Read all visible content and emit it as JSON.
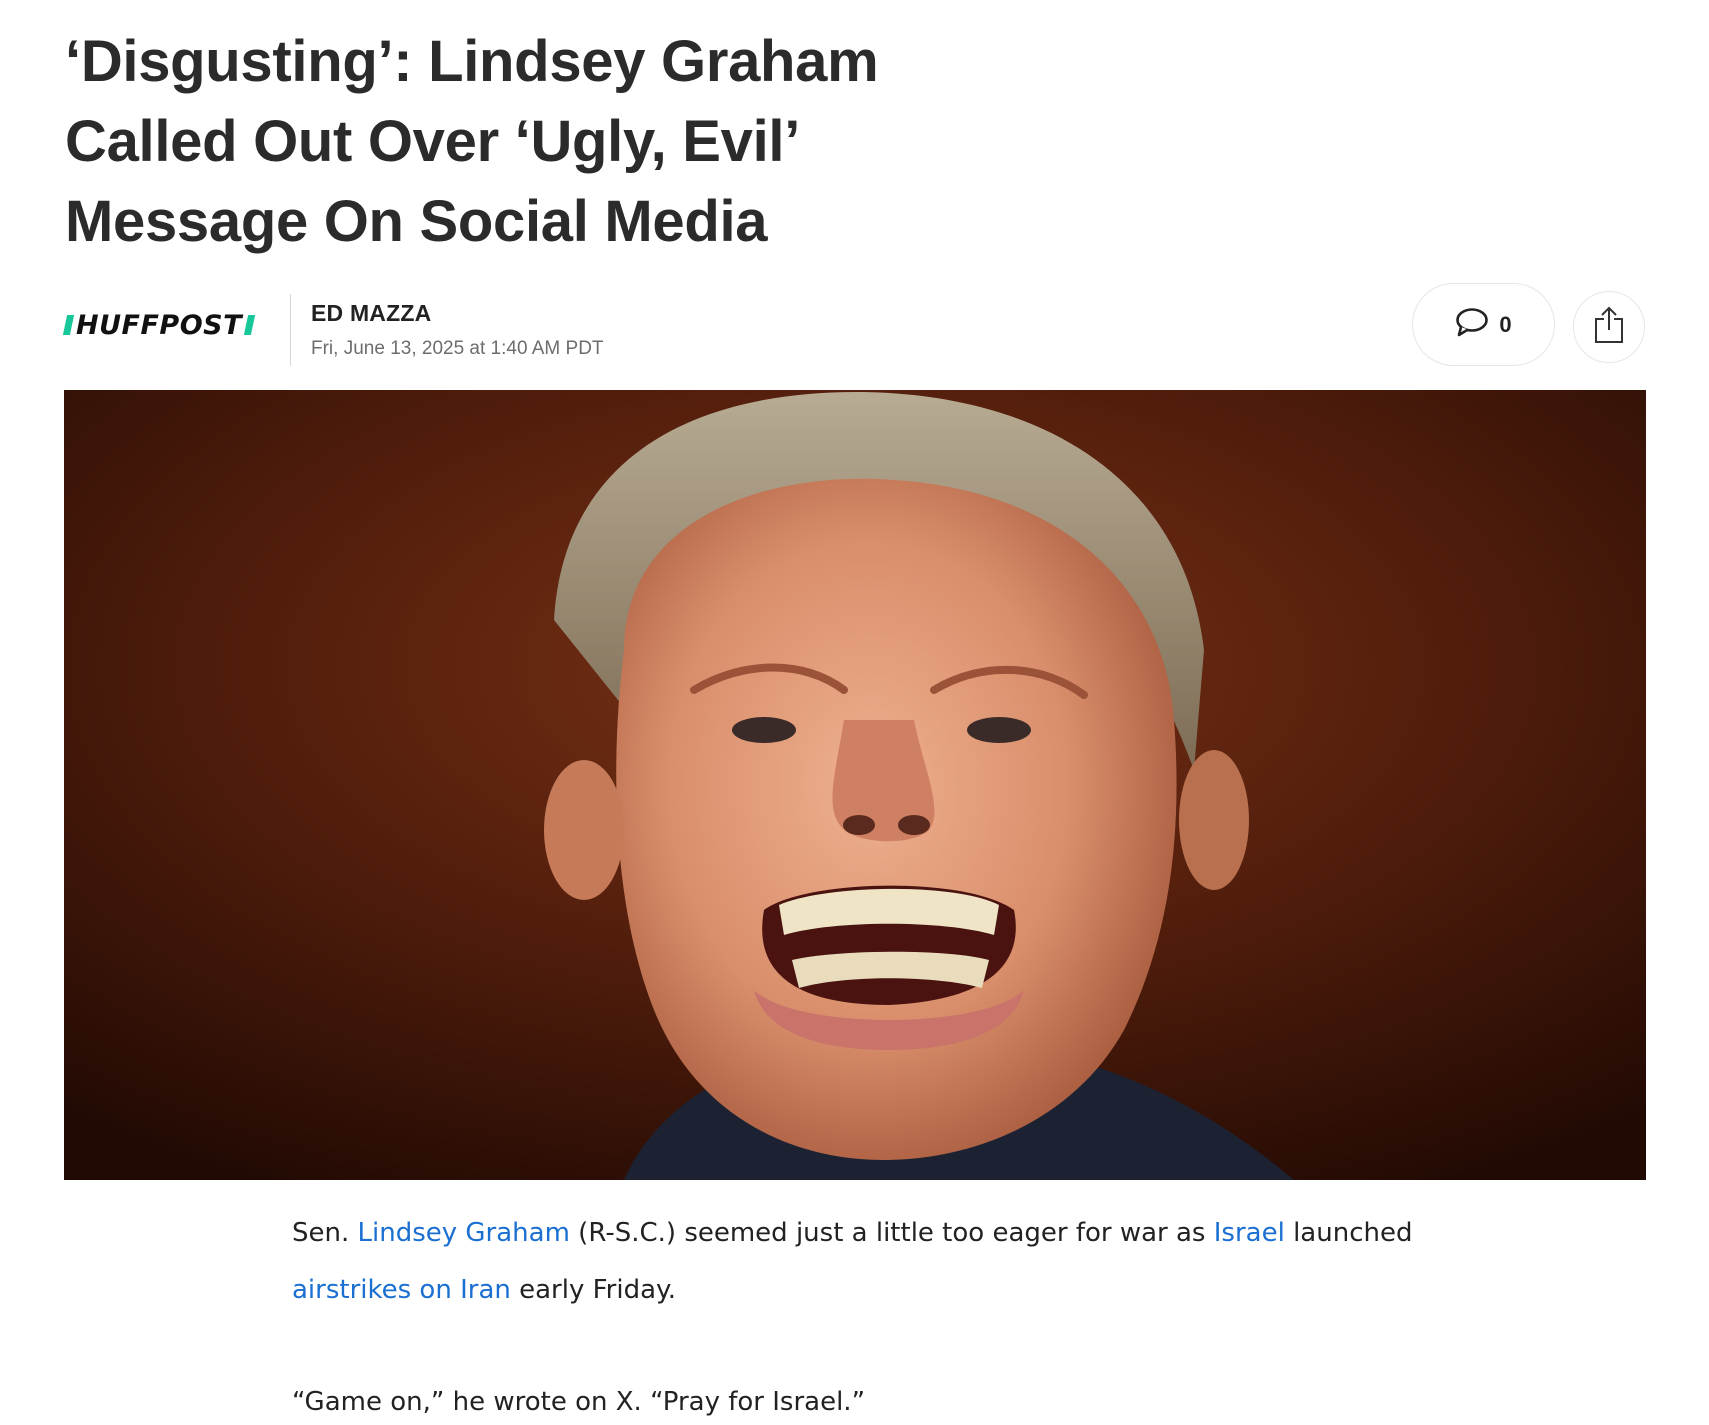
{
  "article": {
    "headline_line1": "‘Disgusting’: Lindsey Graham",
    "headline_line2": "Called Out Over ‘Ugly, Evil’",
    "headline_line3": "Message On Social Media"
  },
  "byline": {
    "publisher": "HUFFPOST",
    "author": "ED MAZZA",
    "timestamp": "Fri, June 13, 2025 at 1:40 AM PDT"
  },
  "actions": {
    "comment_count": "0",
    "comment_icon": "speech-bubble-icon",
    "share_icon": "share-icon"
  },
  "hero_image": {
    "description": "photo-of-man-grimacing"
  },
  "body": {
    "p1_prefix": "Sen. ",
    "p1_link1": "Lindsey Graham",
    "p1_mid": " (R-S.C.) seemed just a little too eager for war as ",
    "p1_link2": "Israel",
    "p1_mid2": " launched ",
    "p1_link3": "airstrikes on Iran",
    "p1_suffix": " early Friday.",
    "p2": "“Game on,” he wrote on X. “Pray for Israel.”"
  },
  "colors": {
    "brand_accent": "#16c79a",
    "link": "#1a6fd1",
    "headline": "#2b2b2b"
  }
}
